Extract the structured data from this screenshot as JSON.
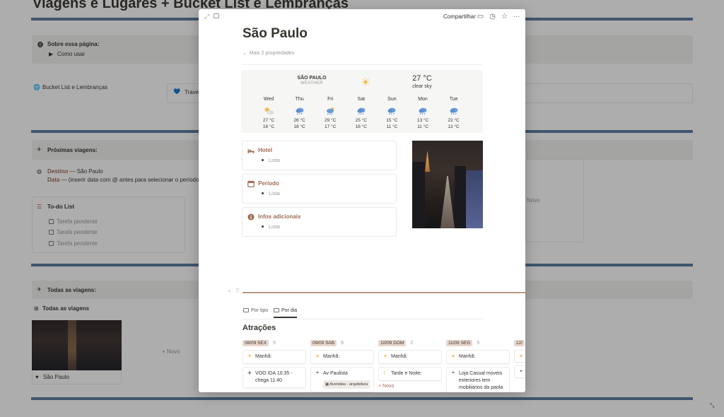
{
  "background_page": {
    "title": "Viagens e Lugares + Bucket List e Lembranças",
    "about": {
      "heading": "Sobre essa página:",
      "toggle": "Como usar"
    },
    "bucket_link": "Bucket List e Lembranças",
    "travel_link": "Trave",
    "next_trips": "Próximas viagens:",
    "destino_label": "Destino",
    "destino_value": " — São Paulo",
    "data_label": "Data",
    "data_value": " — (inserir data com @ antes para selecionar o período)",
    "todo_title": "To-do List",
    "todo_items": [
      "Tarefa pendente",
      "Tarefa pendente",
      "Tarefa pendente"
    ],
    "novo_right": "Novo",
    "all_trips": "Todas as viagens:",
    "all_trips_view": "Todas as viagens",
    "novo_gallery": "+ Novo",
    "gallery_card": "São Paulo"
  },
  "modal": {
    "share": "Compartilhar",
    "title": "São Paulo",
    "more_props": "Mais 2 propriedades",
    "weather": {
      "city": "SÃO PAULO",
      "label": "WEATHER",
      "temp": "27 °C",
      "desc": "clear sky",
      "days": [
        {
          "name": "Wed",
          "icon": "partly-cloudy-icon",
          "hi": "27 °C",
          "lo": "16 °C"
        },
        {
          "name": "Thu",
          "icon": "rain-icon",
          "hi": "26 °C",
          "lo": "18 °C"
        },
        {
          "name": "Fri",
          "icon": "sun-rain-icon",
          "hi": "29 °C",
          "lo": "17 °C"
        },
        {
          "name": "Sat",
          "icon": "rain-icon",
          "hi": "25 °C",
          "lo": "16 °C"
        },
        {
          "name": "Sun",
          "icon": "rain-icon",
          "hi": "15 °C",
          "lo": "11 °C"
        },
        {
          "name": "Mon",
          "icon": "rain-icon",
          "hi": "13 °C",
          "lo": "11 °C"
        },
        {
          "name": "Tue",
          "icon": "rain-icon",
          "hi": "22 °C",
          "lo": "13 °C"
        }
      ]
    },
    "cards": [
      {
        "title": "Hotel",
        "item": "Lista",
        "icon": "bed-icon"
      },
      {
        "title": "Período",
        "item": "Lista",
        "icon": "calendar-icon"
      },
      {
        "title": "Infos adicionais",
        "item": "Lista",
        "icon": "info-icon"
      }
    ],
    "tabs": [
      "Por tipo",
      "Por dia"
    ],
    "active_tab": "Por dia",
    "section_title": "Atrações",
    "board": [
      {
        "date": "08/09 SEX",
        "count": "5",
        "cards": [
          {
            "icon": "sun-icon",
            "text": "Manhã:"
          },
          {
            "icon": "plane-icon",
            "text": "VOO IDA 10:35 - chega 11:40"
          }
        ]
      },
      {
        "date": "09/09 SAB",
        "count": "6",
        "cards": [
          {
            "icon": "sun-icon",
            "text": "Manhã:"
          },
          {
            "icon": "pin-icon",
            "text": "Av Paulista",
            "tag": "Avenidas - arquitetura"
          }
        ]
      },
      {
        "date": "10/09 DOM",
        "count": "2",
        "cards": [
          {
            "icon": "sun-icon",
            "text": "Manhã:"
          },
          {
            "icon": "moon-icon",
            "text": "Tarde e Noite:"
          }
        ],
        "new": "+ Novo"
      },
      {
        "date": "11/09 SEG",
        "count": "5",
        "cards": [
          {
            "icon": "sun-icon",
            "text": "Manhã:"
          },
          {
            "icon": "pin-icon",
            "text": "Loja Casual moveis exteriores tem mobiliarios da paola"
          }
        ]
      },
      {
        "date": "12/",
        "count": "",
        "cards": [
          {
            "icon": "sun-icon",
            "text": ""
          },
          {
            "icon": "pin-icon",
            "text": ""
          }
        ]
      }
    ]
  },
  "colors": {
    "accent_brown": "#9f6b53",
    "bar_blue": "#5a7a9e",
    "tag_bg": "#ead7ce"
  }
}
